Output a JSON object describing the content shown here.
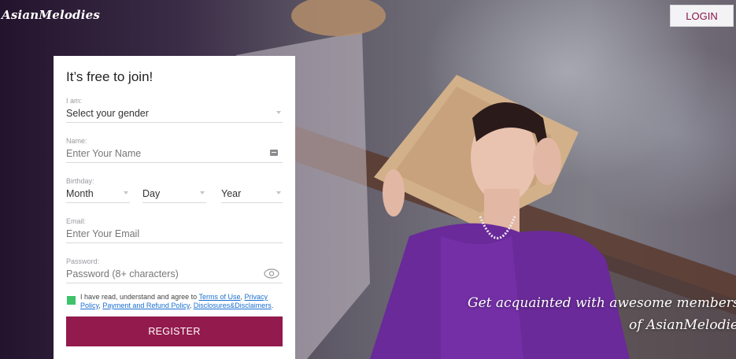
{
  "header": {
    "logo": "AsianMelodies",
    "login_label": "LOGIN"
  },
  "form": {
    "title": "It’s free to join!",
    "gender": {
      "label": "I am:",
      "value": "Select your gender"
    },
    "name": {
      "label": "Name:",
      "placeholder": "Enter Your Name"
    },
    "birthday": {
      "label": "Birthday:",
      "month": "Month",
      "day": "Day",
      "year": "Year"
    },
    "email": {
      "label": "Email:",
      "placeholder": "Enter Your Email"
    },
    "password": {
      "label": "Password:",
      "placeholder": "Password (8+ characters)"
    },
    "consent": {
      "prefix": "I have read, understand and agree to ",
      "link1": "Terms of Use",
      "sep1": ", ",
      "link2": "Privacy Policy",
      "sep2": ", ",
      "link3": "Payment and Refund Policy",
      "sep3": ", ",
      "link4": "Disclosures&Disclaimers",
      "suffix": "."
    },
    "register_label": "REGISTER"
  },
  "hero": {
    "tagline_line1": "Get acquainted with awesome members",
    "tagline_line2": "of AsianMelodies!"
  },
  "colors": {
    "accent": "#931a4d",
    "login_text": "#8a1447",
    "checkbox": "#3ec36a",
    "dress": "#6a2a9a"
  }
}
